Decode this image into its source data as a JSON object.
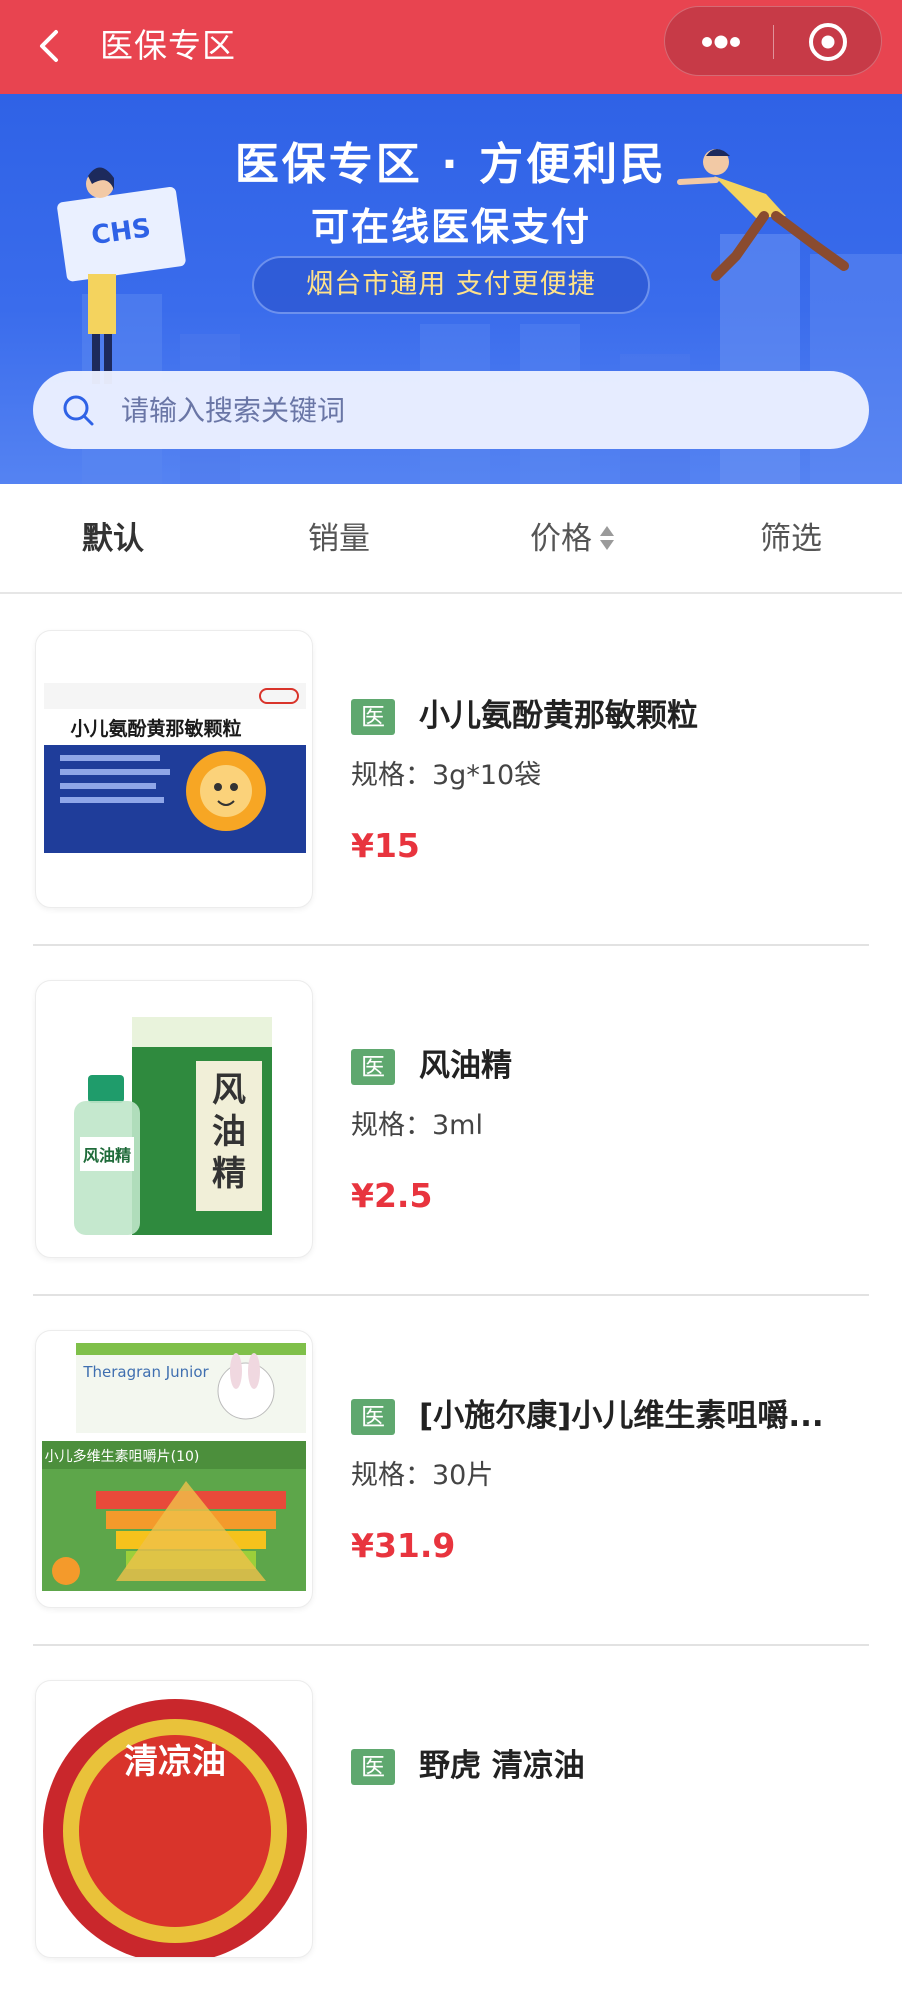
{
  "navbar": {
    "title": "医保专区",
    "back_icon": "chevron-left-icon",
    "more_icon": "more-dots-icon",
    "close_icon": "target-close-icon",
    "bg_color": "#e84450"
  },
  "banner": {
    "title": "医保专区 · 方便利民",
    "subtitle": "可在线医保支付",
    "pill": "烟台市通用  支付更便捷",
    "sign_text": "CHS",
    "bg_color": "#3a6cec",
    "pill_text_color": "#ffe28a"
  },
  "search": {
    "placeholder": "请输入搜索关键词",
    "icon": "search-icon"
  },
  "tabs": [
    {
      "label": "默认",
      "active": true
    },
    {
      "label": "销量",
      "active": false
    },
    {
      "label": "价格",
      "active": false,
      "icon": "sort-arrows-icon"
    },
    {
      "label": "筛选",
      "active": false
    }
  ],
  "products": [
    {
      "badge": "医",
      "name": "小儿氨酚黄那敏颗粒",
      "spec": "规格：3g*10袋",
      "price": "¥15",
      "thumb_label": "小儿氨酚黄那敏颗粒"
    },
    {
      "badge": "医",
      "name": "风油精",
      "spec": "规格：3ml",
      "price": "¥2.5",
      "thumb_label": "风油精"
    },
    {
      "badge": "医",
      "name": "[小施尔康]小儿维生素咀嚼...",
      "spec": "规格：30片",
      "price": "¥31.9",
      "thumb_label": "小儿多维生素咀嚼片(10)",
      "thumb_brand": "Theragran Junior"
    },
    {
      "badge": "医",
      "name": "野虎 清凉油",
      "spec": "",
      "price": "",
      "thumb_label": "清凉油"
    }
  ],
  "colors": {
    "badge": "#5fa86f",
    "price": "#e8343e"
  }
}
